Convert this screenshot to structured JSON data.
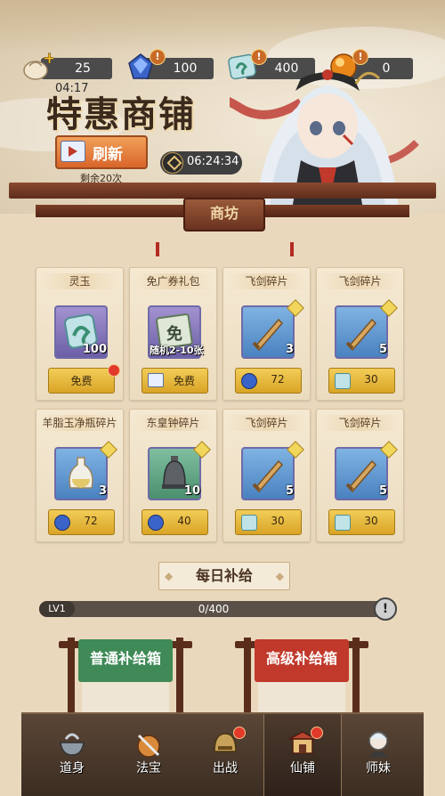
{
  "resources": [
    {
      "icon": "bun-currency-icon",
      "value": "25"
    },
    {
      "icon": "blue-gem-icon",
      "value": "100"
    },
    {
      "icon": "jade-ticket-icon",
      "value": "400"
    },
    {
      "icon": "gold-orb-icon",
      "value": "0"
    }
  ],
  "header": {
    "timer_small": "04:17",
    "title": "特惠商铺",
    "refresh_label": "刷新",
    "remaining": "剩余20次",
    "countdown": "06:24:34",
    "plaque": "商坊"
  },
  "shop_items": [
    {
      "name": "灵玉",
      "count": "100",
      "price": "免费",
      "free": true,
      "red_dot": true,
      "frame": "purple",
      "icon": "jade-ticket-icon"
    },
    {
      "name": "免广券礼包",
      "count": "随机2-10张",
      "price": "免费",
      "free": true,
      "red_dot": false,
      "frame": "purple",
      "icon": "coupon-icon"
    },
    {
      "name": "飞剑碎片",
      "count": "3",
      "price": "72",
      "free": false,
      "red_dot": false,
      "frame": "blue",
      "icon": "sword-icon",
      "currency": "gem"
    },
    {
      "name": "飞剑碎片",
      "count": "5",
      "price": "30",
      "free": false,
      "red_dot": false,
      "frame": "blue",
      "icon": "sword-icon",
      "currency": "jade"
    },
    {
      "name": "羊脂玉净瓶碎片",
      "count": "3",
      "price": "72",
      "free": false,
      "red_dot": false,
      "frame": "blue",
      "icon": "vase-icon",
      "currency": "gem"
    },
    {
      "name": "东皇钟碎片",
      "count": "10",
      "price": "40",
      "free": false,
      "red_dot": false,
      "frame": "green",
      "icon": "bell-icon",
      "currency": "gem"
    },
    {
      "name": "飞剑碎片",
      "count": "5",
      "price": "30",
      "free": false,
      "red_dot": false,
      "frame": "blue",
      "icon": "sword-icon",
      "currency": "jade"
    },
    {
      "name": "飞剑碎片",
      "count": "5",
      "price": "30",
      "free": false,
      "red_dot": false,
      "frame": "blue",
      "icon": "sword-icon",
      "currency": "jade"
    }
  ],
  "daily": {
    "title": "每日补给",
    "level": "LV1",
    "progress_text": "0/400",
    "progress": 0,
    "boxes": [
      {
        "label": "普通补给箱",
        "color": "#3f8a57"
      },
      {
        "label": "高级补给箱",
        "color": "#c0392b"
      }
    ]
  },
  "nav": [
    {
      "label": "道身",
      "icon": "cauldron-icon",
      "red_dot": false,
      "active": false
    },
    {
      "label": "法宝",
      "icon": "treasure-icon",
      "red_dot": false,
      "active": false
    },
    {
      "label": "出战",
      "icon": "helmet-icon",
      "red_dot": true,
      "active": false
    },
    {
      "label": "仙铺",
      "icon": "shop-icon",
      "red_dot": true,
      "active": true
    },
    {
      "label": "师妹",
      "icon": "disciple-icon",
      "red_dot": false,
      "active": false
    }
  ],
  "colors": {
    "accent_gold": "#e5b73b",
    "red_dot": "#e23a2a",
    "wood": "#6a3220"
  }
}
